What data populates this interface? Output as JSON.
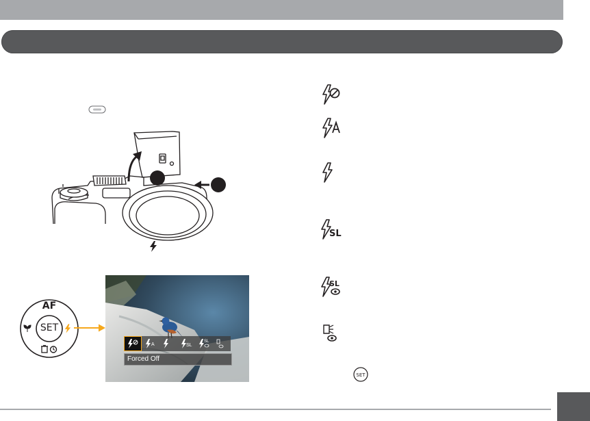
{
  "dial": {
    "top_label": "AF",
    "center_label": "SET"
  },
  "preview": {
    "selected_mode_label": "Forced Off",
    "mode_icons": [
      "flash-forced-off",
      "flash-auto",
      "flash-forced",
      "flash-slow-sync",
      "flash-slow-sync-red-eye",
      "red-eye-reduction"
    ]
  },
  "flash_modes": {
    "icons": [
      "flash-forced-off-icon",
      "flash-auto-icon",
      "flash-forced-icon",
      "flash-slow-sync-icon",
      "flash-slow-sync-red-eye-icon",
      "red-eye-reduction-icon"
    ]
  },
  "colors": {
    "header_gray": "#a7a9ac",
    "section_bar": "#58595b",
    "accent_orange": "#f6a81c"
  }
}
